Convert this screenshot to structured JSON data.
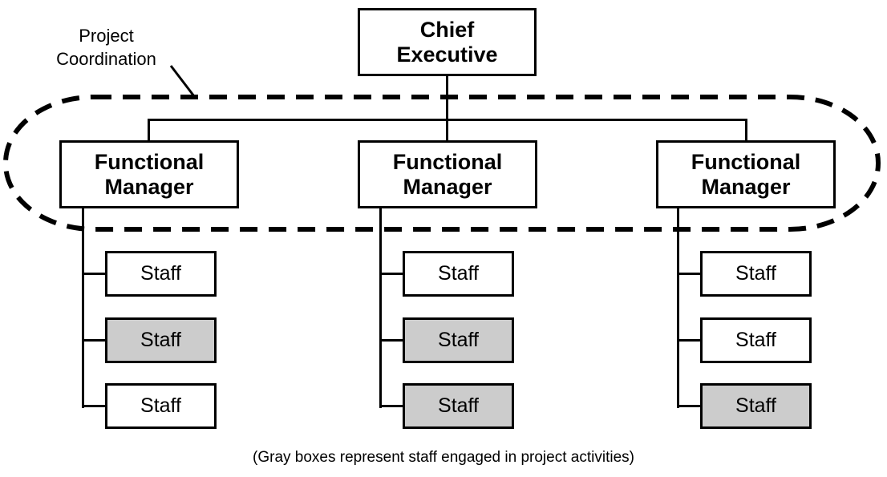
{
  "diagram": {
    "project_coordination_label": [
      "Project",
      "Coordination"
    ],
    "chief": [
      "Chief",
      "Executive"
    ],
    "managers": [
      {
        "title": [
          "Functional",
          "Manager"
        ],
        "staff": [
          {
            "label": "Staff",
            "engaged": false
          },
          {
            "label": "Staff",
            "engaged": true
          },
          {
            "label": "Staff",
            "engaged": false
          }
        ]
      },
      {
        "title": [
          "Functional",
          "Manager"
        ],
        "staff": [
          {
            "label": "Staff",
            "engaged": false
          },
          {
            "label": "Staff",
            "engaged": true
          },
          {
            "label": "Staff",
            "engaged": true
          }
        ]
      },
      {
        "title": [
          "Functional",
          "Manager"
        ],
        "staff": [
          {
            "label": "Staff",
            "engaged": false
          },
          {
            "label": "Staff",
            "engaged": false
          },
          {
            "label": "Staff",
            "engaged": true
          }
        ]
      }
    ],
    "caption": "(Gray boxes represent staff engaged in project activities)",
    "colors": {
      "engaged_fill": "#cccccc",
      "stroke": "#000000"
    }
  }
}
